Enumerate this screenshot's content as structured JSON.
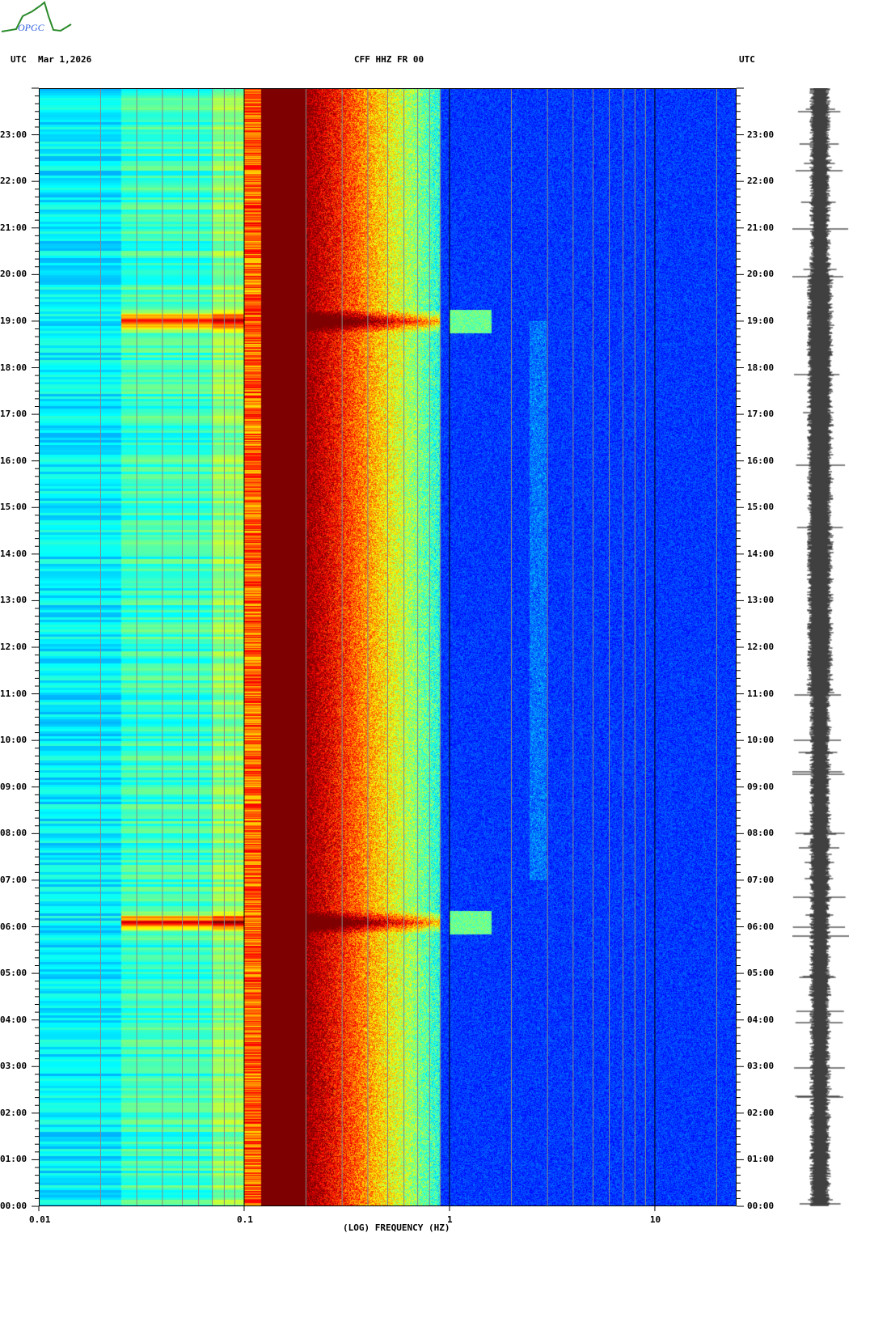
{
  "logo_text": "OPGC",
  "header": {
    "left_tz": "UTC",
    "date": "Mar 1,2026",
    "station": "CFF HHZ FR 00",
    "right_tz": "UTC"
  },
  "chart_data": {
    "type": "heatmap",
    "title": "CFF HHZ FR 00",
    "date": "Mar 1,2026",
    "xlabel": "(LOG) FREQUENCY (HZ)",
    "xscale": "log",
    "xlim": [
      0.01,
      25
    ],
    "x_ticks": [
      "0.01",
      "0.1",
      "1",
      "10"
    ],
    "x_tick_values": [
      0.01,
      0.1,
      1,
      10
    ],
    "ylim_hours": [
      0,
      24
    ],
    "y_ticks": [
      "00:00",
      "01:00",
      "02:00",
      "03:00",
      "04:00",
      "05:00",
      "06:00",
      "07:00",
      "08:00",
      "09:00",
      "10:00",
      "11:00",
      "12:00",
      "13:00",
      "14:00",
      "15:00",
      "16:00",
      "17:00",
      "18:00",
      "19:00",
      "20:00",
      "21:00",
      "22:00",
      "23:00"
    ],
    "events_hours": [
      6.1,
      19.0
    ],
    "colormap": "jet"
  }
}
